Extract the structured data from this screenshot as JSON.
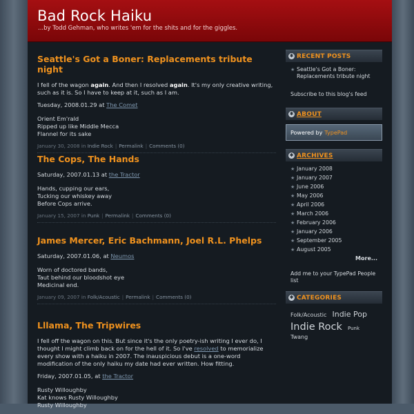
{
  "blog": {
    "title": "Bad Rock Haiku",
    "tagline": "...by Todd Gehman, who writes 'em for the shits and for the giggles."
  },
  "posts": [
    {
      "title": "Seattle's Got a Boner: Replacements tribute night",
      "body_1": "I fell of the wagon ",
      "body_bold_1": "again",
      "body_2": ".  And then I resolved ",
      "body_bold_2": "again",
      "body_3": ".  It's my only creative writing, such as it is.  So I have to keep at it, such as I am.",
      "date_line": "Tuesday, 2008.01.29 at ",
      "venue": "The Comet",
      "haiku": [
        "Orient Em'rald",
        "Ripped up like Middle Mecca",
        "Flannel for its sake"
      ],
      "meta_date": "January 30, 2008 in",
      "meta_cat": "Indie Rock",
      "meta_permalink": "Permalink",
      "meta_comments": "Comments (0)"
    },
    {
      "title": "The Cops, The Hands",
      "date_line": "Saturday, 2007.01.13 at ",
      "venue": "the Tractor",
      "haiku": [
        "Hands, cupping our ears,",
        "Tucking our whiskey away",
        "Before Cops arrive."
      ],
      "meta_date": "January 15, 2007 in",
      "meta_cat": "Punk",
      "meta_permalink": "Permalink",
      "meta_comments": "Comments (0)"
    },
    {
      "title": "James Mercer, Eric Bachmann, Joel R.L. Phelps",
      "date_line": "Saturday, 2007.01.06, at ",
      "venue": "Neumos",
      "haiku": [
        "Worn of doctored bands,",
        "Taut behind our bloodshot eye",
        "Medicinal end."
      ],
      "meta_date": "January 09, 2007 in",
      "meta_cat": "Folk/Acoustic",
      "meta_permalink": "Permalink",
      "meta_comments": "Comments (0)"
    },
    {
      "title": "Lllama, The Tripwires",
      "body_1": "I fell off the wagon on this.  But since it's the only poetry-ish writing I ever do, I thought I might climb back on for the hell of it.  So I've ",
      "link": "resolved",
      "body_2": " to memorialize every show with a haiku in 2007.  The inauspicious debut is a one-word modification of the only haiku my date had ever written.  How fitting.",
      "date_line": "Friday, 2007.01.05, at ",
      "venue": "the Tractor",
      "haiku": [
        "Rusty Willoughby",
        "Kat knows Rusty Willoughby",
        "Rusty Willoughby"
      ]
    }
  ],
  "sidebar": {
    "recent_title": "RECENT POSTS",
    "recent_items": [
      "Seattle's Got a Boner: Replacements tribute night"
    ],
    "subscribe": "Subscribe to this blog's feed",
    "about_title": "ABOUT",
    "powered_by": "Powered by",
    "powered_brand": "TypePad",
    "archives_title": "ARCHIVES",
    "archives": [
      "January 2008",
      "January 2007",
      "June 2006",
      "May 2006",
      "April 2006",
      "March 2006",
      "February 2006",
      "January 2006",
      "September 2005",
      "August 2005"
    ],
    "more": "More...",
    "add_me": "Add me to your TypePad People list",
    "categories_title": "CATEGORIES",
    "categories": [
      {
        "name": "Folk/Acoustic",
        "size": "small"
      },
      {
        "name": "Indie Pop",
        "size": "medium"
      },
      {
        "name": "Indie Rock",
        "size": "large"
      },
      {
        "name": "Punk",
        "size": "tiny"
      },
      {
        "name": "Twang",
        "size": "small"
      }
    ]
  },
  "colors": {
    "banner": "#a50f12",
    "accent": "#f0921e",
    "background": "#151b21"
  }
}
